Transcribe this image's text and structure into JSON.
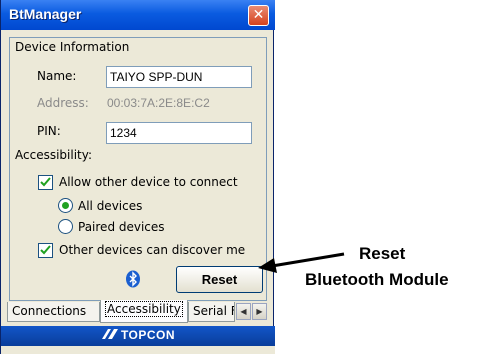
{
  "window": {
    "title": "BtManager",
    "close_glyph": "✕"
  },
  "device_info": {
    "heading": "Device Information",
    "name_label": "Name:",
    "name_value": "TAIYO SPP-DUN",
    "address_label": "Address:",
    "address_value": "00:03:7A:2E:8E:C2",
    "pin_label": "PIN:",
    "pin_value": "1234"
  },
  "accessibility": {
    "heading": "Accessibility:",
    "allow_connect": {
      "label": "Allow other device to connect",
      "checked": true
    },
    "radio_all": {
      "label": "All devices",
      "selected": true
    },
    "radio_paired": {
      "label": "Paired devices",
      "selected": false
    },
    "discoverable": {
      "label": "Other devices can discover me",
      "checked": true
    }
  },
  "reset_button": {
    "label": "Reset",
    "icon": "bluetooth-icon"
  },
  "tabs": {
    "items": [
      {
        "label": "Connections",
        "active": false
      },
      {
        "label": "Accessibility",
        "active": true
      },
      {
        "label": "Serial F",
        "active": false
      }
    ],
    "scroll_left": "◀",
    "scroll_right": "▶"
  },
  "brand": {
    "text": "TOPCON"
  },
  "annotation": {
    "line1": "Reset",
    "line2": "Bluetooth Module"
  },
  "colors": {
    "titlebar": "#0a5be0",
    "close": "#d5421e",
    "brand_bar": "#0a3d9a",
    "radio_dot": "#21a121"
  }
}
